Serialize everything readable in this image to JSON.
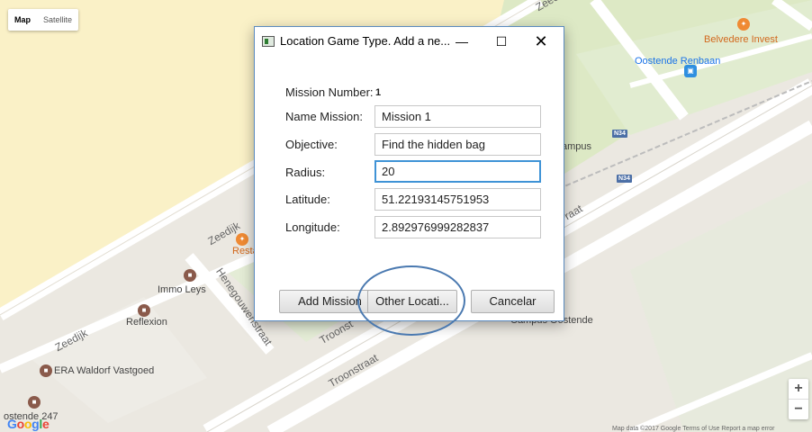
{
  "map": {
    "type_control": {
      "map_label": "Map",
      "satellite_label": "Satellite",
      "selected": "Map"
    },
    "places": {
      "belvedere": "Belvedere Invest",
      "oostende_renbaan": "Oostende Renbaan",
      "immo_leys": "Immo Leys",
      "reflexion": "Reflexion",
      "era_waldorf": "ERA Waldorf Vastgoed",
      "restaurant_partial": "Resta",
      "ostende_247": "ostende 247",
      "campus_partial": "ampus",
      "campus_oostende": "Campus Oostende"
    },
    "roads": {
      "zeedijk_top": "Zeedijk",
      "zeedijk_mid": "Zeedijk",
      "zeedijk_low": "Zeedijk",
      "henegouwenstraat": "Henegouwenstraat",
      "troonstraat_1": "Troonst",
      "troonstraat_2": "Troonstraat",
      "troonstraat_3": "raat"
    },
    "shields": [
      "N34",
      "N34"
    ],
    "zoom": {
      "in": "+",
      "out": "−"
    },
    "logo": "Google",
    "footer": "Map data ©2017 Google    Terms of Use    Report a map error"
  },
  "colors": {
    "beach": "#faf1c7",
    "land": "#ebe8e1",
    "green": "#dde9c5",
    "road": "#ffffff",
    "dialog_border": "#5b8bbf",
    "focus": "#3f93d6",
    "annotation": "#4a79b0"
  },
  "icons": {
    "app": "java-app-icon",
    "minimize": "minimize-icon",
    "maximize": "maximize-icon",
    "close": "close-icon"
  },
  "dialog": {
    "title": "Location Game Type. Add a ne...",
    "minimize_glyph": "—",
    "maximize_glyph": "☐",
    "close_glyph": "✕",
    "fields": {
      "mission_number": {
        "label": "Mission Number:",
        "value": "1"
      },
      "name_mission": {
        "label": "Name Mission:",
        "value": "Mission 1"
      },
      "objective": {
        "label": "Objective:",
        "value": "Find the hidden bag"
      },
      "radius": {
        "label": "Radius:",
        "value": "20"
      },
      "latitude": {
        "label": "Latitude:",
        "value": "51.22193145751953"
      },
      "longitude": {
        "label": "Longitude:",
        "value": "2.892976999282837"
      }
    },
    "buttons": {
      "add_mission": "Add Mission",
      "other_location": "Other Locati...",
      "cancel": "Cancelar"
    }
  }
}
